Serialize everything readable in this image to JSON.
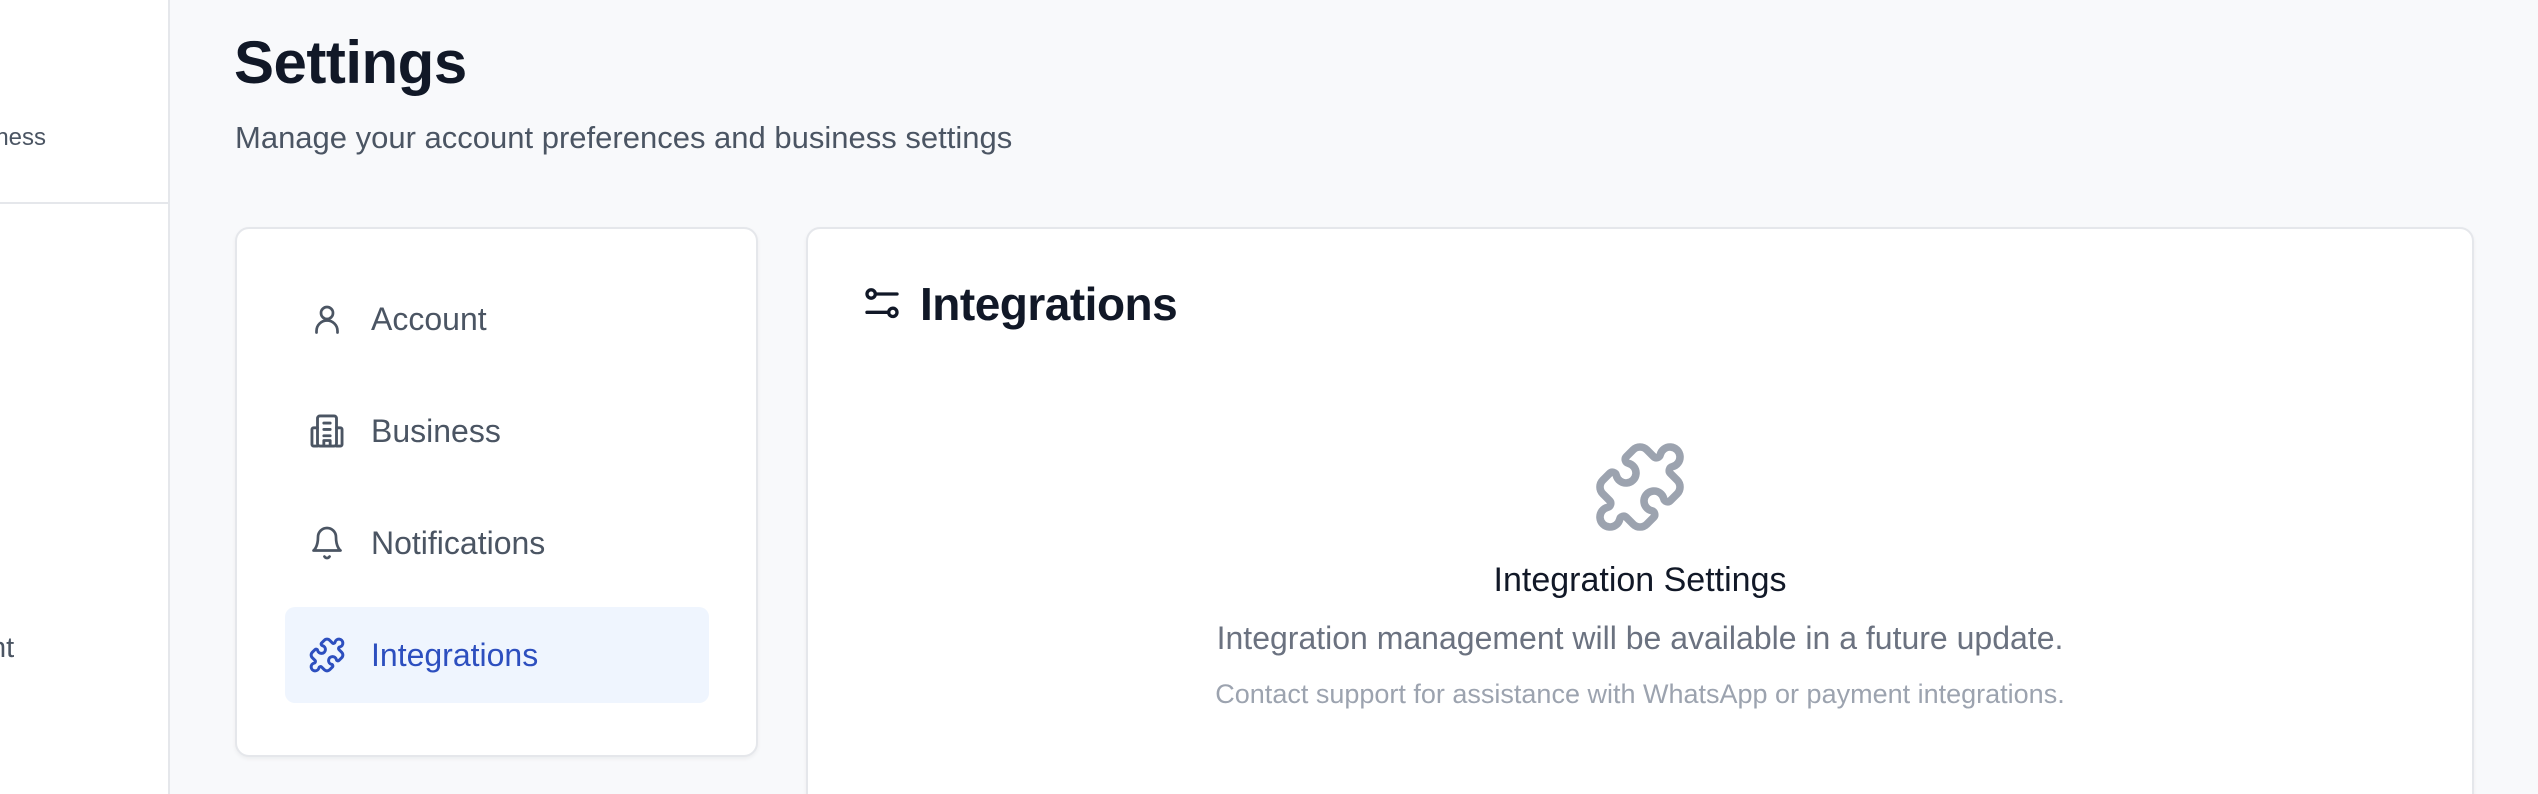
{
  "app_sidebar": {
    "subtitle_fragment": "siness",
    "item_fragment": "nt"
  },
  "header": {
    "title": "Settings",
    "subtitle": "Manage your account preferences and business settings"
  },
  "settings_nav": {
    "items": [
      {
        "label": "Account",
        "icon": "user-icon",
        "active": false
      },
      {
        "label": "Business",
        "icon": "building-icon",
        "active": false
      },
      {
        "label": "Notifications",
        "icon": "bell-icon",
        "active": false
      },
      {
        "label": "Integrations",
        "icon": "puzzle-icon",
        "active": true
      }
    ]
  },
  "content": {
    "title": "Integrations",
    "title_icon": "sliders-icon",
    "empty_state": {
      "icon": "puzzle-icon",
      "title": "Integration Settings",
      "description": "Integration management will be available in a future update.",
      "note": "Contact support for assistance with WhatsApp or payment integrations."
    }
  },
  "colors": {
    "background": "#f8f9fb",
    "active_item_bg": "#eff5fe",
    "active_item_text": "#2d4fbf",
    "muted_text": "#4b5563",
    "border": "#e5e7eb"
  }
}
